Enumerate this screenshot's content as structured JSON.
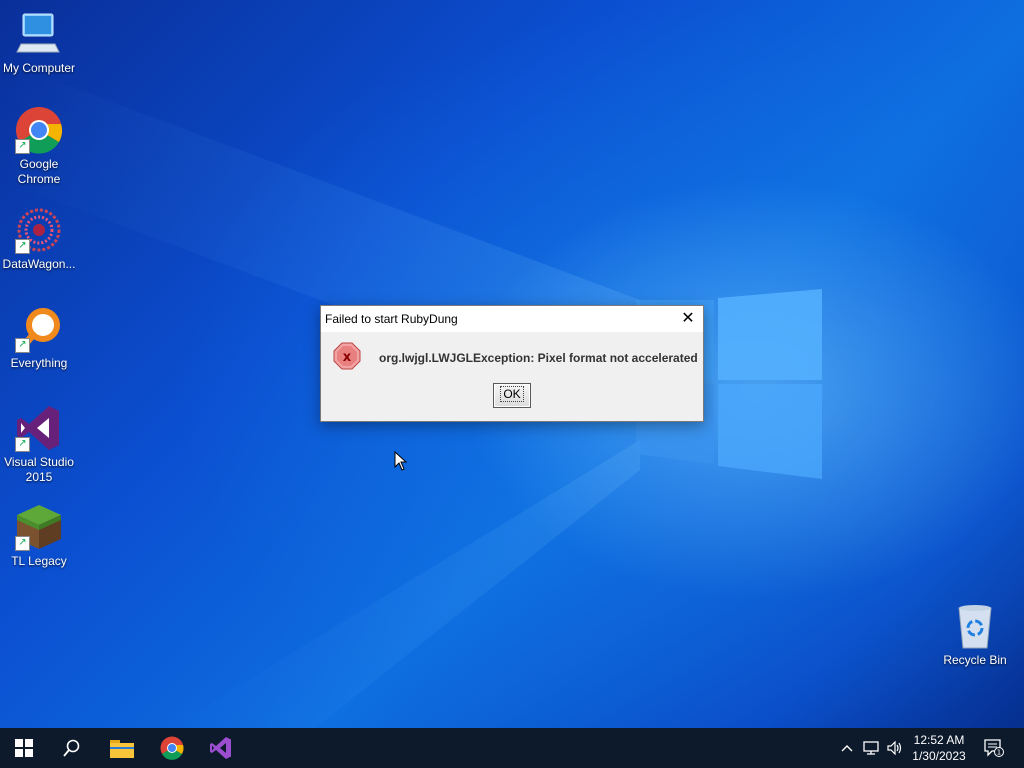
{
  "desktop": {
    "icons": [
      {
        "label": "My Computer",
        "icon": "computer-icon"
      },
      {
        "label": "Google Chrome",
        "icon": "chrome-icon"
      },
      {
        "label": "DataWagon...",
        "icon": "datawagon-icon"
      },
      {
        "label": "Everything",
        "icon": "everything-search-icon"
      },
      {
        "label": "Visual Studio 2015",
        "icon": "visual-studio-icon"
      },
      {
        "label": "TL Legacy",
        "icon": "minecraft-grass-block-icon"
      },
      {
        "label": "Recycle Bin",
        "icon": "recycle-bin-icon"
      }
    ]
  },
  "dialog": {
    "title": "Failed to start RubyDung",
    "close_label": "✕",
    "message": "org.lwjgl.LWJGLException: Pixel format not accelerated",
    "ok_label": "OK",
    "icon": "error-icon"
  },
  "taskbar": {
    "items": [
      "start-icon",
      "search-icon",
      "file-explorer-icon",
      "chrome-icon",
      "visual-studio-icon"
    ],
    "tray": [
      "chevron-up-icon",
      "network-icon",
      "volume-icon"
    ],
    "time": "12:52 AM",
    "date": "1/30/2023",
    "notification_count": "1"
  },
  "colors": {
    "taskbar": "#0d1a2b",
    "desktop_blue": "#0b4fd1"
  }
}
